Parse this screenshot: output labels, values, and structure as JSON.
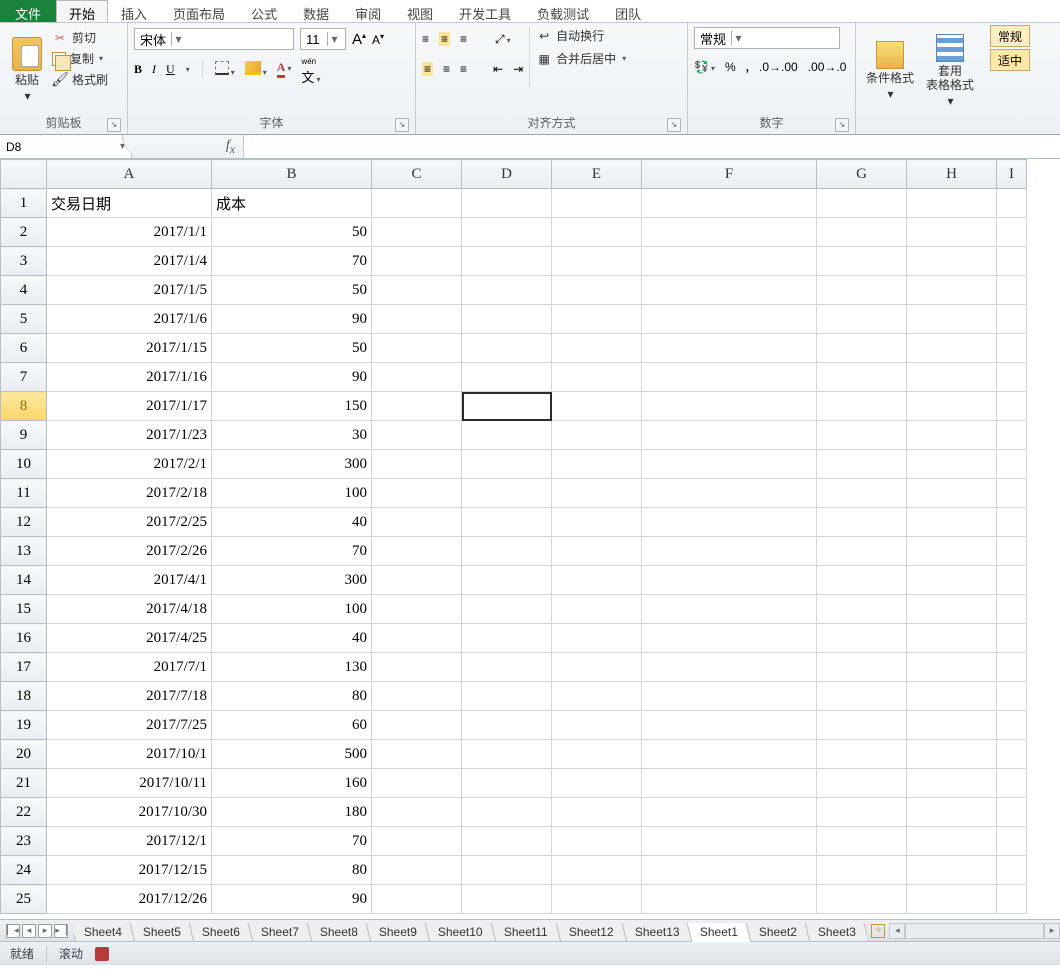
{
  "menu": {
    "file": "文件",
    "tabs": [
      "开始",
      "插入",
      "页面布局",
      "公式",
      "数据",
      "审阅",
      "视图",
      "开发工具",
      "负载测试",
      "团队"
    ],
    "active_index": 0
  },
  "ribbon": {
    "clipboard": {
      "label": "剪贴板",
      "paste": "粘贴",
      "cut": "剪切",
      "copy": "复制",
      "format_painter": "格式刷"
    },
    "font": {
      "label": "字体",
      "name": "宋体",
      "size": "11",
      "grow": "A",
      "shrink": "A",
      "bold": "B",
      "italic": "I",
      "underline": "U",
      "phonetic_label": "wén"
    },
    "alignment": {
      "label": "对齐方式",
      "wrap": "自动换行",
      "merge": "合并后居中"
    },
    "number": {
      "label": "数字",
      "format": "常规",
      "percent": "%",
      "comma": ","
    },
    "styles": {
      "cond": "条件格式",
      "table": "套用\n表格格式",
      "cell1": "常规",
      "cell2": "适中"
    }
  },
  "nameBox": "D8",
  "formula": "",
  "columns": [
    "A",
    "B",
    "C",
    "D",
    "E",
    "F",
    "G",
    "H",
    "I"
  ],
  "headers": {
    "A": "交易日期",
    "B": "成本"
  },
  "rows": [
    {
      "A": "2017/1/1",
      "B": "50"
    },
    {
      "A": "2017/1/4",
      "B": "70"
    },
    {
      "A": "2017/1/5",
      "B": "50"
    },
    {
      "A": "2017/1/6",
      "B": "90"
    },
    {
      "A": "2017/1/15",
      "B": "50"
    },
    {
      "A": "2017/1/16",
      "B": "90"
    },
    {
      "A": "2017/1/17",
      "B": "150"
    },
    {
      "A": "2017/1/23",
      "B": "30"
    },
    {
      "A": "2017/2/1",
      "B": "300"
    },
    {
      "A": "2017/2/18",
      "B": "100"
    },
    {
      "A": "2017/2/25",
      "B": "40"
    },
    {
      "A": "2017/2/26",
      "B": "70"
    },
    {
      "A": "2017/4/1",
      "B": "300"
    },
    {
      "A": "2017/4/18",
      "B": "100"
    },
    {
      "A": "2017/4/25",
      "B": "40"
    },
    {
      "A": "2017/7/1",
      "B": "130"
    },
    {
      "A": "2017/7/18",
      "B": "80"
    },
    {
      "A": "2017/7/25",
      "B": "60"
    },
    {
      "A": "2017/10/1",
      "B": "500"
    },
    {
      "A": "2017/10/11",
      "B": "160"
    },
    {
      "A": "2017/10/30",
      "B": "180"
    },
    {
      "A": "2017/12/1",
      "B": "70"
    },
    {
      "A": "2017/12/15",
      "B": "80"
    },
    {
      "A": "2017/12/26",
      "B": "90"
    }
  ],
  "activeCell": {
    "row": 8,
    "col": "D"
  },
  "sheetTabs": [
    "Sheet4",
    "Sheet5",
    "Sheet6",
    "Sheet7",
    "Sheet8",
    "Sheet9",
    "Sheet10",
    "Sheet11",
    "Sheet12",
    "Sheet13",
    "Sheet1",
    "Sheet2",
    "Sheet3"
  ],
  "sheetActive": "Sheet1",
  "status": {
    "ready": "就绪",
    "scroll": "滚动"
  }
}
